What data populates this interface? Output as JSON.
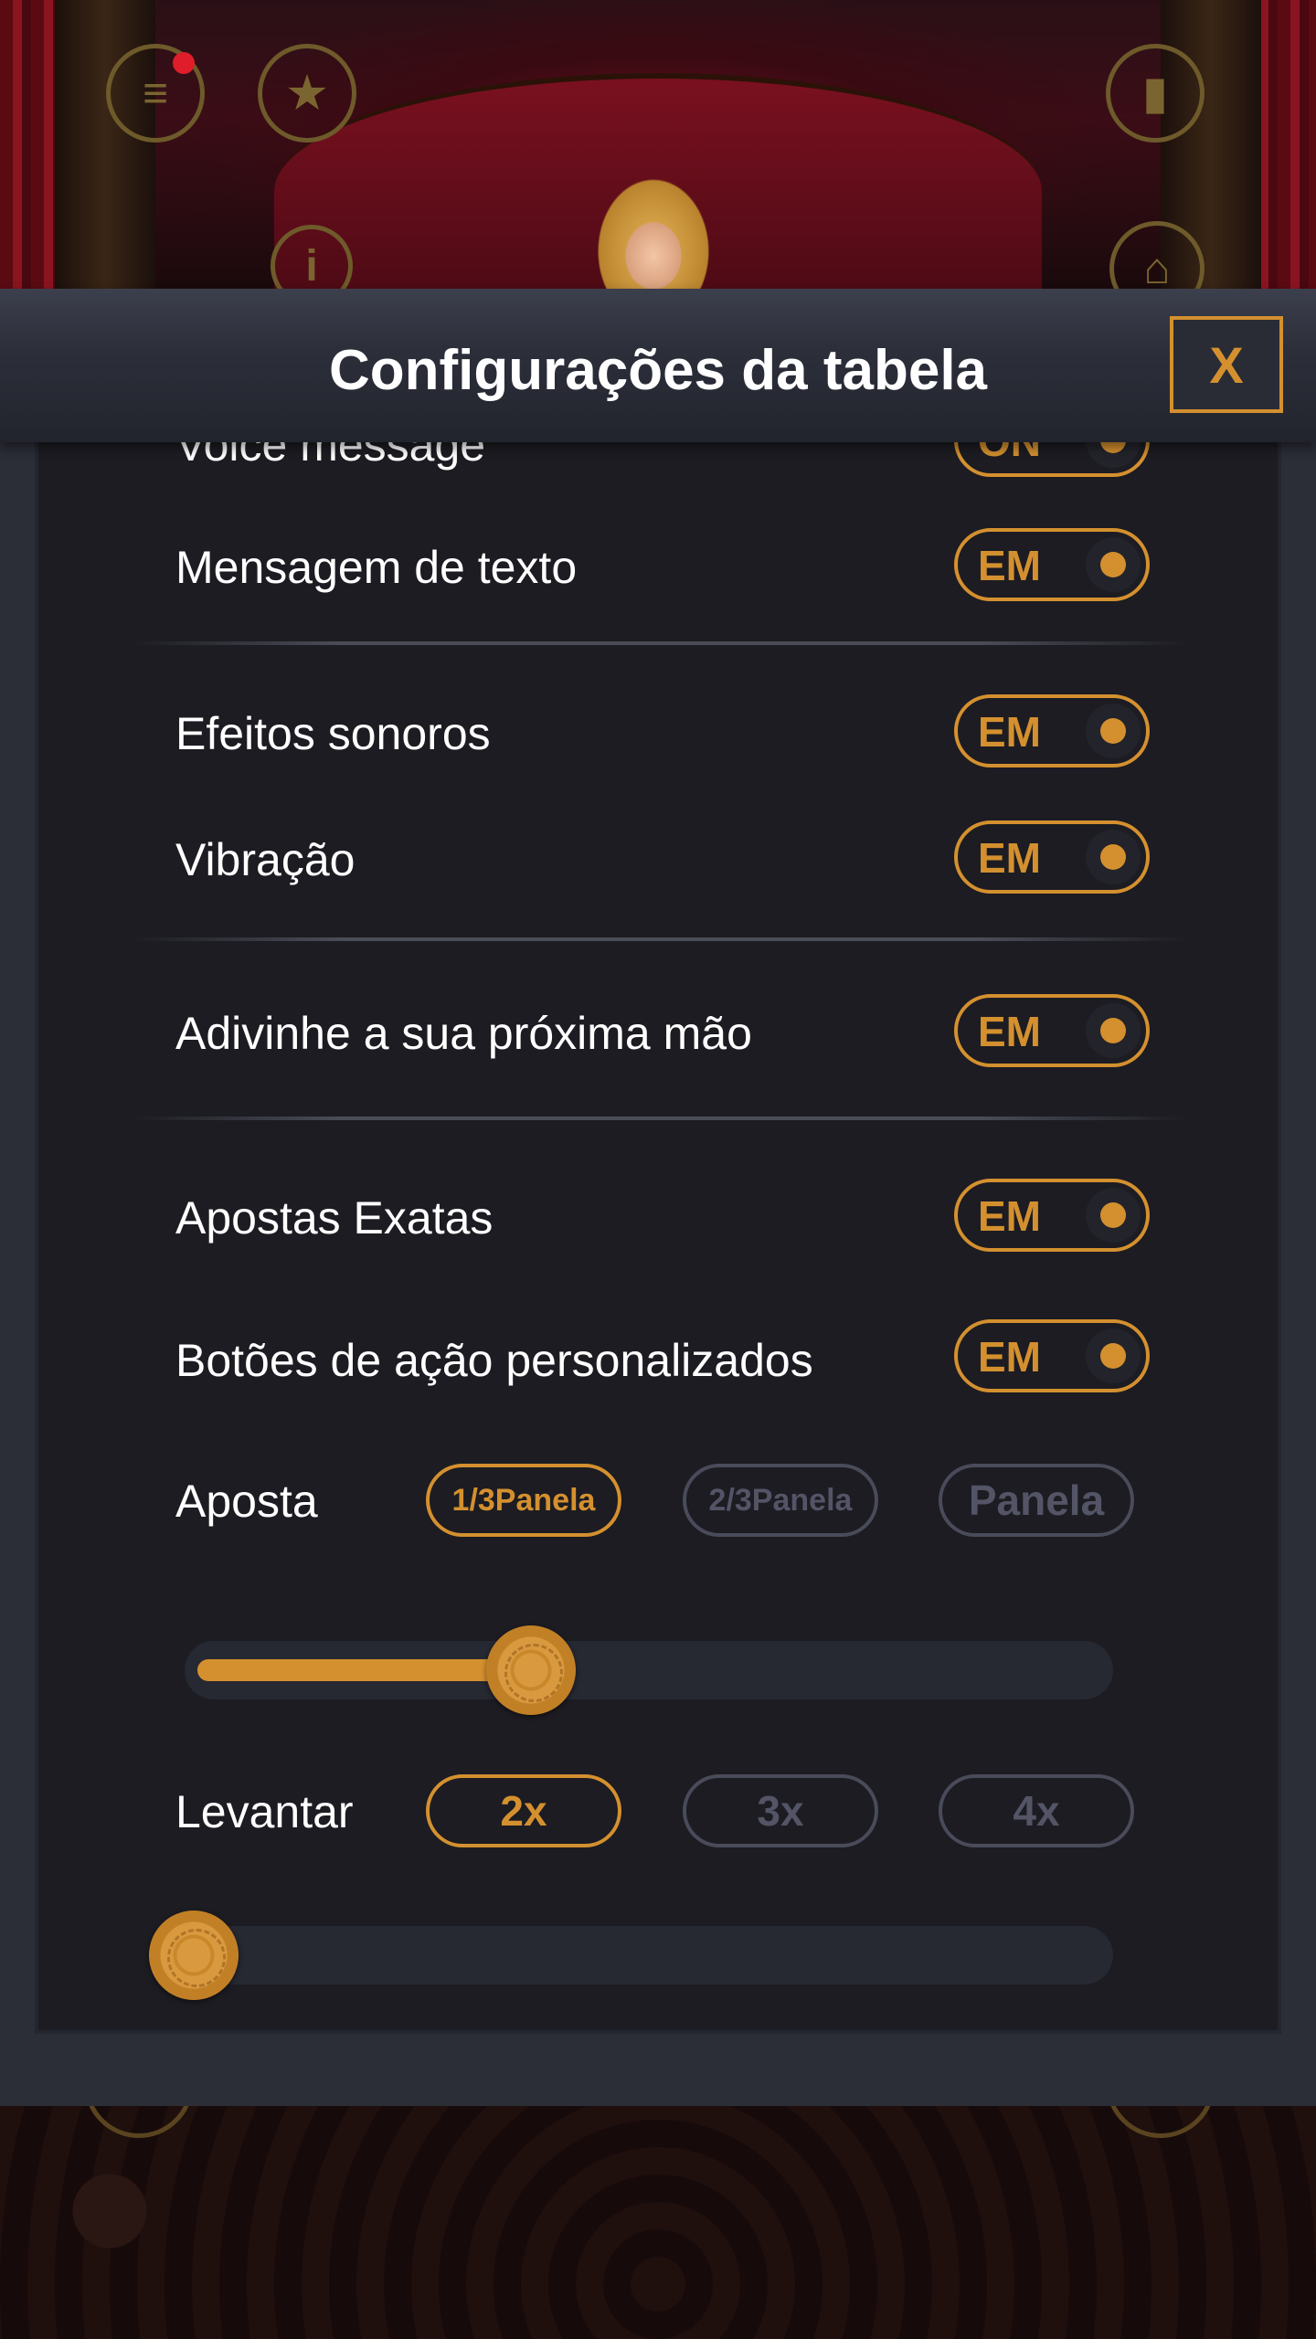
{
  "modal": {
    "title": "Configurações da tabela",
    "close_label": "X"
  },
  "settings": {
    "voice_message": {
      "label": "Voice message",
      "toggle": "ON"
    },
    "text_message": {
      "label": "Mensagem de texto",
      "toggle": "EM"
    },
    "sound_effects": {
      "label": "Efeitos sonoros",
      "toggle": "EM"
    },
    "vibration": {
      "label": "Vibração",
      "toggle": "EM"
    },
    "guess_next_hand": {
      "label": "Adivinhe a sua próxima mão",
      "toggle": "EM"
    },
    "exact_bets": {
      "label": "Apostas Exatas",
      "toggle": "EM"
    },
    "custom_action_buttons": {
      "label": "Botões de ação personalizados",
      "toggle": "EM"
    }
  },
  "bet": {
    "label": "Aposta",
    "options": [
      "1/3Panela",
      "2/3Panela",
      "Panela"
    ],
    "selected": "1/3Panela",
    "slider_level": 0.37
  },
  "raise": {
    "label": "Levantar",
    "options": [
      "2x",
      "3x",
      "4x"
    ],
    "selected": "2x",
    "slider_level": 0.0
  },
  "colors": {
    "accent": "#d4902f",
    "panel": "#1c1c22",
    "modal": "#2b2d37"
  },
  "icons": {
    "top_left": [
      "menu-icon",
      "bookmark-star-icon",
      "info-icon"
    ],
    "top_right": [
      "stats-bars-icon",
      "shop-basket-icon"
    ]
  }
}
